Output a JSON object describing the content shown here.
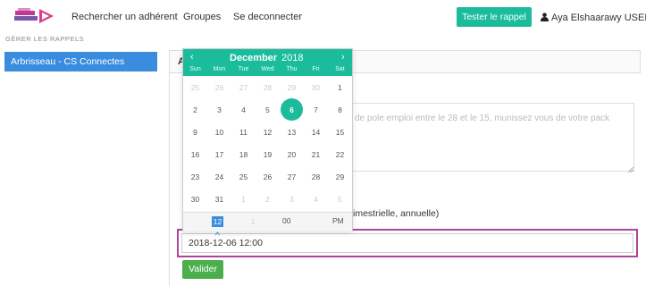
{
  "nav": {
    "links": [
      "Rechercher un adhérent",
      "Groupes",
      "Se deconnecter"
    ],
    "tester_button": "Tester le rappel",
    "user_name": "Aya Elshaarawy USER"
  },
  "sidebar": {
    "title": "GÉRER LES RAPPELS",
    "items": [
      {
        "label": "Arbrisseau - CS Connectes",
        "active": true
      }
    ]
  },
  "main": {
    "panel_header_letter": "A",
    "message_text": "de pole emploi entre le 28 et le 15, munissez vous de votre pack",
    "periodicity_text": "imestrielle, annuelle)",
    "date_value": "2018-12-06 12:00",
    "submit_label": "Valider"
  },
  "datepicker": {
    "prev": "‹",
    "next": "›",
    "month": "December",
    "year": "2018",
    "weekdays": [
      "Sun",
      "Mon",
      "Tue",
      "Wed",
      "Thu",
      "Fri",
      "Sat"
    ],
    "weeks": [
      [
        "25",
        "26",
        "27",
        "28",
        "29",
        "30",
        "1"
      ],
      [
        "2",
        "3",
        "4",
        "5",
        "6",
        "7",
        "8"
      ],
      [
        "9",
        "10",
        "11",
        "12",
        "13",
        "14",
        "15"
      ],
      [
        "16",
        "17",
        "18",
        "19",
        "20",
        "21",
        "22"
      ],
      [
        "23",
        "24",
        "25",
        "26",
        "27",
        "28",
        "29"
      ],
      [
        "30",
        "31",
        "1",
        "2",
        "3",
        "4",
        "5"
      ]
    ],
    "selected_day": "6",
    "time": {
      "hour": "12",
      "separator": ":",
      "minute": "00",
      "ampm": "PM"
    }
  },
  "colors": {
    "accent_teal": "#1abc9c",
    "sidebar_blue": "#3a8dde",
    "highlight_border": "#b0449c",
    "valider_green": "#4cae4c"
  },
  "icons": {
    "logo": "connected-logo",
    "user": "user-icon",
    "resize": "resize-handle-icon",
    "time_up": "chevron-up-icon"
  }
}
